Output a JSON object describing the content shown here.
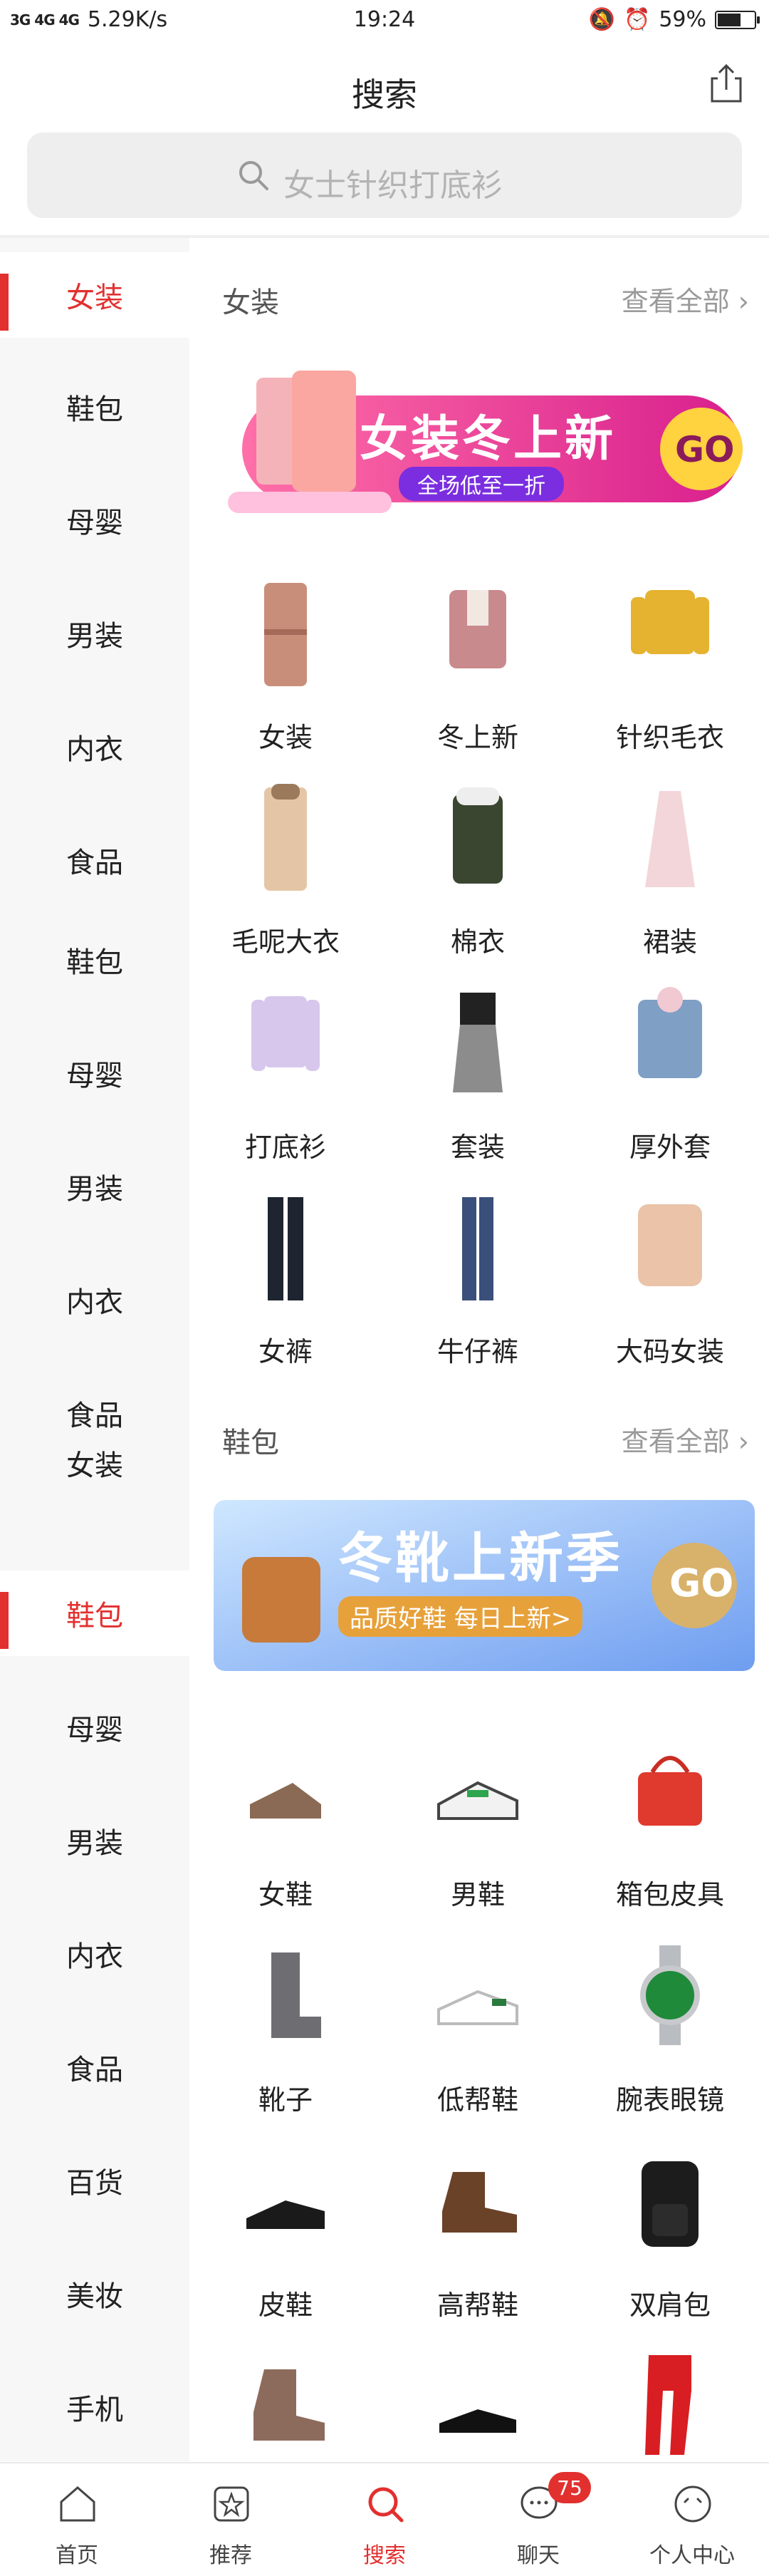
{
  "status_bar": {
    "network": "3G 4G 4G",
    "speed": "5.29K/s",
    "time": "19:24",
    "battery": "59%"
  },
  "header": {
    "title": "搜索"
  },
  "search": {
    "placeholder": "女士针织打底衫"
  },
  "sidebar": {
    "items": [
      "女装",
      "鞋包",
      "母婴",
      "男装",
      "内衣",
      "食品",
      "鞋包",
      "母婴",
      "男装",
      "内衣",
      "食品",
      "女装",
      "鞋包",
      "母婴",
      "男装",
      "内衣",
      "食品",
      "百货",
      "美妆",
      "手机"
    ]
  },
  "sections": [
    {
      "title": "女装",
      "see_all": "查看全部",
      "banner": {
        "headline": "女装冬上新",
        "sub": "全场低至一折",
        "go": "GO"
      },
      "items": [
        "女装",
        "冬上新",
        "针织毛衣",
        "毛呢大衣",
        "棉衣",
        "裙装",
        "打底衫",
        "套装",
        "厚外套",
        "女裤",
        "牛仔裤",
        "大码女装"
      ]
    },
    {
      "title": "鞋包",
      "see_all": "查看全部",
      "banner": {
        "headline": "冬靴上新季",
        "sub": "品质好鞋 每日上新>",
        "go": "GO"
      },
      "items": [
        "女鞋",
        "男鞋",
        "箱包皮具",
        "靴子",
        "低帮鞋",
        "腕表眼镜",
        "皮鞋",
        "高帮鞋",
        "双肩包",
        "",
        "",
        ""
      ]
    }
  ],
  "bottom_nav": {
    "tabs": [
      "首页",
      "推荐",
      "搜索",
      "聊天",
      "个人中心"
    ],
    "chat_badge": "75"
  },
  "colors": {
    "accent": "#e2302f"
  }
}
